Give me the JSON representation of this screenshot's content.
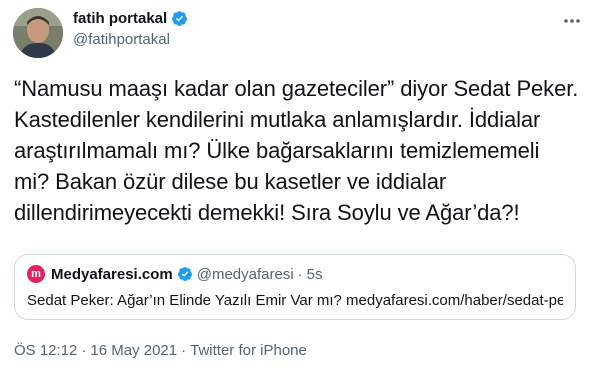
{
  "author": {
    "display_name": "fatih portakal",
    "handle": "@fatihportakal"
  },
  "tweet": {
    "text": "“Namusu maaşı kadar olan gazeteciler” diyor Sedat Peker. Kastedilenler kendilerini mutlaka anlamışlardır. İddialar araştırılmamalı mı? Ülke bağarsaklarını temizlememeli mi? Bakan özür dilese bu kasetler ve iddialar dillendirimeyecekti demekki! Sıra Soylu ve Ağar’da?!"
  },
  "quote": {
    "logo_letter": "m",
    "display_name": "Medyafaresi.com",
    "handle": "@medyafaresi",
    "separator": "·",
    "time": "5s",
    "text": "Sedat Peker: Ağar’ın Elinde Yazılı Emir Var mı? medyafaresi.com/haber/sedat-pe..."
  },
  "meta": {
    "time": "ÖS 12:12",
    "dot1": "·",
    "date": "16 May 2021",
    "dot2": "·",
    "source": "Twitter for iPhone"
  },
  "colors": {
    "verified": "#1d9bf0",
    "quote_logo": "#e0245e",
    "secondary_text": "#536471"
  },
  "icons": {
    "verified": "verified-badge-icon",
    "more": "more-options-icon"
  }
}
